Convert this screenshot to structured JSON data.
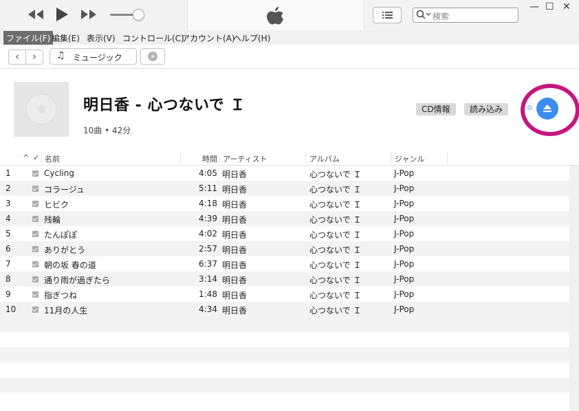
{
  "player": {
    "search_placeholder": "検索"
  },
  "menu": [
    {
      "label": "ファイル(F)",
      "active": true
    },
    {
      "label": "編集(E)"
    },
    {
      "label": "表示(V)"
    },
    {
      "label": "コントロール(C)"
    },
    {
      "label": "アカウント(A)"
    },
    {
      "label": "ヘルプ(H)"
    }
  ],
  "nav": {
    "library_label": "ミュージック"
  },
  "album": {
    "title": "明日香 - 心つないで Ｉ",
    "meta": "10曲 • 42分",
    "cd_info_label": "CD情報",
    "import_label": "読み込み"
  },
  "columns": {
    "name": "名前",
    "time": "時間",
    "artist": "アーティスト",
    "album": "アルバム",
    "genre": "ジャンル",
    "check": "✓",
    "sort": "^"
  },
  "tracks": [
    {
      "num": "1",
      "name": "Cycling",
      "time": "4:05",
      "artist": "明日香",
      "album": "心つないで Ｉ",
      "genre": "J-Pop"
    },
    {
      "num": "2",
      "name": "コラージュ",
      "time": "5:11",
      "artist": "明日香",
      "album": "心つないで Ｉ",
      "genre": "J-Pop"
    },
    {
      "num": "3",
      "name": "ヒビク",
      "time": "4:18",
      "artist": "明日香",
      "album": "心つないで Ｉ",
      "genre": "J-Pop"
    },
    {
      "num": "4",
      "name": "残輪",
      "time": "4:39",
      "artist": "明日香",
      "album": "心つないで Ｉ",
      "genre": "J-Pop"
    },
    {
      "num": "5",
      "name": "たんぽぽ",
      "time": "4:02",
      "artist": "明日香",
      "album": "心つないで Ｉ",
      "genre": "J-Pop"
    },
    {
      "num": "6",
      "name": "ありがとう",
      "time": "2:57",
      "artist": "明日香",
      "album": "心つないで Ｉ",
      "genre": "J-Pop"
    },
    {
      "num": "7",
      "name": "朝の坂 春の道",
      "time": "6:37",
      "artist": "明日香",
      "album": "心つないで Ｉ",
      "genre": "J-Pop"
    },
    {
      "num": "8",
      "name": "通り雨が過ぎたら",
      "time": "3:14",
      "artist": "明日香",
      "album": "心つないで Ｉ",
      "genre": "J-Pop"
    },
    {
      "num": "9",
      "name": "指ぎつね",
      "time": "1:48",
      "artist": "明日香",
      "album": "心つないで Ｉ",
      "genre": "J-Pop"
    },
    {
      "num": "10",
      "name": "11月の人生",
      "time": "4:34",
      "artist": "明日香",
      "album": "心つないで Ｉ",
      "genre": "J-Pop"
    }
  ],
  "colors": {
    "eject_button": "#3d8df0",
    "highlight_ring": "#c5177e"
  }
}
